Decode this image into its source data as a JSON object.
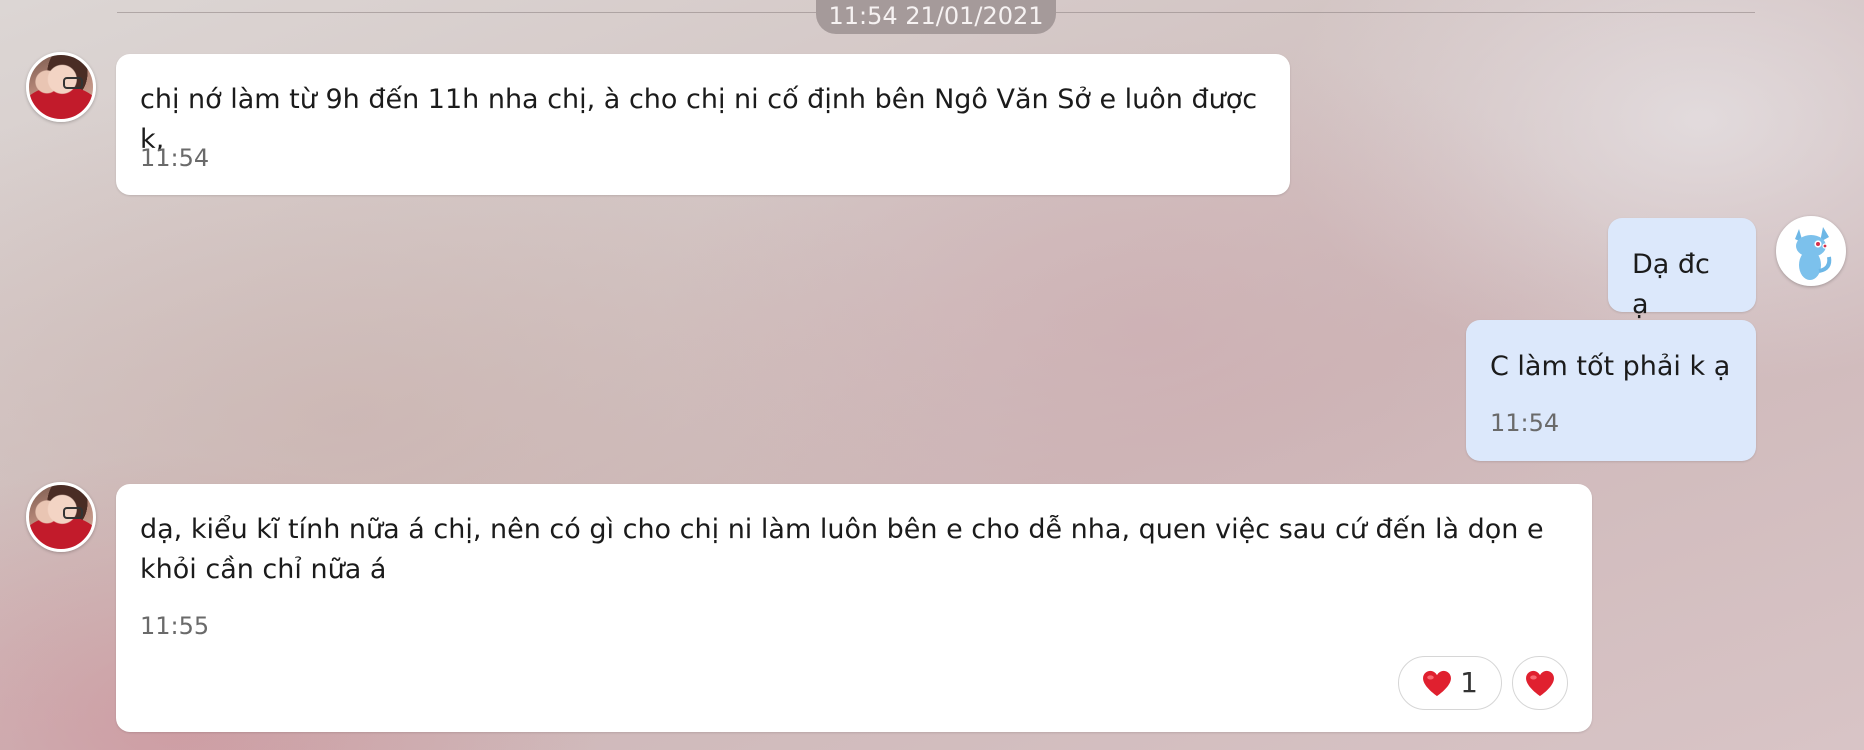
{
  "date_separator": "11:54 21/01/2021",
  "messages": [
    {
      "id": "msg1",
      "direction": "incoming",
      "text": "chị nớ làm từ 9h đến 11h nha chị, à cho chị ni cố định bên Ngô Văn Sở e luôn được k,",
      "time": "11:54"
    },
    {
      "id": "msg2",
      "direction": "outgoing",
      "text": "Dạ đc ạ"
    },
    {
      "id": "msg3",
      "direction": "outgoing",
      "text": "C làm tốt phải k ạ",
      "time": "11:54"
    },
    {
      "id": "msg4",
      "direction": "incoming",
      "text": "dạ, kiểu kĩ tính nữa á chị, nên có gì cho chị ni làm luôn bên e cho dễ nha, quen việc sau cứ đến là dọn e khỏi cần chỉ nữa á",
      "time": "11:55",
      "reaction": {
        "icon": "heart-icon",
        "count": "1"
      },
      "quick_react_icon": "heart-icon"
    }
  ],
  "colors": {
    "incoming_bubble": "#ffffff",
    "outgoing_bubble": "#dce8fb",
    "heart": "#e0202f",
    "date_pill": "#a59a9a"
  }
}
